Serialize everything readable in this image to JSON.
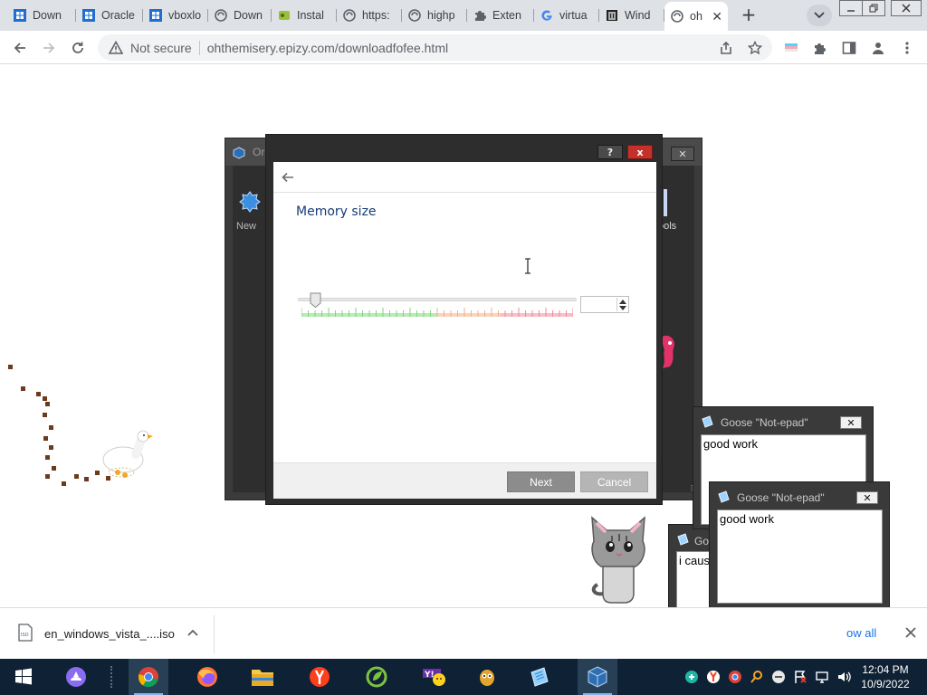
{
  "browser": {
    "tabs": [
      {
        "label": "Down",
        "icon": "windows-logo-icon"
      },
      {
        "label": "Oracle",
        "icon": "windows-logo-icon"
      },
      {
        "label": "vboxlo",
        "icon": "windows-logo-icon"
      },
      {
        "label": "Down",
        "icon": "globe-icon"
      },
      {
        "label": "Instal",
        "icon": "app-icon"
      },
      {
        "label": "https:",
        "icon": "globe-icon"
      },
      {
        "label": "highp",
        "icon": "globe-icon"
      },
      {
        "label": "Exten",
        "icon": "puzzle-icon"
      },
      {
        "label": "virtua",
        "icon": "google-icon"
      },
      {
        "label": "Wind",
        "icon": "building-icon"
      },
      {
        "label": "oh",
        "icon": "globe-icon",
        "active": true
      }
    ],
    "security_text": "Not secure",
    "url": "ohthemisery.epizy.com/downloadfofee.html"
  },
  "vbox_manager": {
    "title": "Or",
    "new_label": "New",
    "tools_label": "ools"
  },
  "wizard": {
    "page_title": "Memory size",
    "help_label": "?",
    "close_label": "x",
    "memory_value": "",
    "next_label": "Next",
    "cancel_label": "Cancel"
  },
  "goose_notepads": [
    {
      "title": "Goose \"Not-epad\"",
      "text": "good work"
    },
    {
      "title": "Goose \"Not-epad\"",
      "text": "good work"
    },
    {
      "title": "Go",
      "text": "i caus"
    }
  ],
  "downloads": {
    "file_name": "en_windows_vista_....iso",
    "show_all": "ow all"
  },
  "taskbar": {
    "time": "12:04 PM",
    "date": "10/9/2022"
  },
  "colors": {
    "wizard_title": "#143c79",
    "slider_green": "#7ed77a",
    "slider_orange": "#f1b184",
    "slider_red": "#f08a9a"
  }
}
